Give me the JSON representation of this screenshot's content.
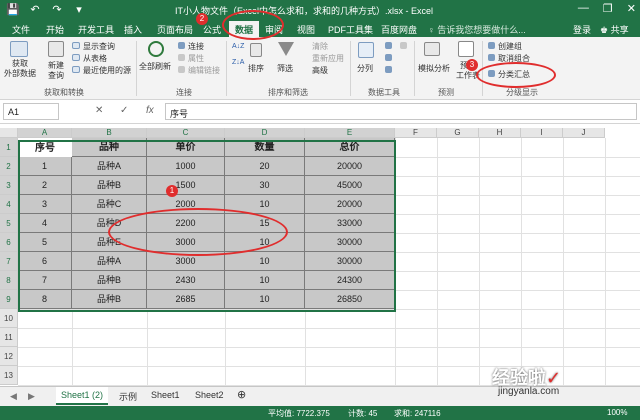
{
  "title_bar": {
    "title": "IT小人物文件（Excel中怎么求和，求和的几种方式）.xlsx - Excel",
    "qat": [
      "💾",
      "↶",
      "↷",
      "▾"
    ],
    "win_controls": [
      "—",
      "❐",
      "✕"
    ]
  },
  "tabs": {
    "items": [
      "文件",
      "开始",
      "开发工具",
      "插入",
      "页面布局",
      "公式",
      "数据",
      "审阅",
      "视图",
      "PDF工具集",
      "百度网盘"
    ],
    "active": "数据",
    "tell_me": "♀ 告诉我您想要做什么...",
    "login": "登录",
    "share": "♚ 共享"
  },
  "ribbon": {
    "get_external": "获取\n外部数据",
    "new_query": "新建\n查询",
    "show_query": "显示查询",
    "from_table": "从表格",
    "recent_sources": "最近使用的源",
    "group_get_transform": "获取和转换",
    "refresh_all": "全部刷新",
    "connections": "连接",
    "properties": "属性",
    "edit_links": "编辑链接",
    "group_connections": "连接",
    "sort_az": "A↓Z",
    "sort_za": "Z↓A",
    "sort": "排序",
    "filter": "筛选",
    "clear": "清除",
    "reapply": "重新应用",
    "advanced": "高级",
    "group_sort_filter": "排序和筛选",
    "split": "分列",
    "group_data_tools": "数据工具",
    "whatif": "模拟分析",
    "forecast": "预测\n工作表",
    "group_forecast": "预测",
    "group_combine": "创建组",
    "ungroup": "取消组合",
    "subtotal": "分类汇总",
    "group_outline": "分级显示"
  },
  "formula_bar": {
    "name_box": "A1",
    "cancel": "✕",
    "enter": "✓",
    "fx": "fx",
    "content": "序号"
  },
  "columns": [
    "A",
    "B",
    "C",
    "D",
    "E",
    "F",
    "G",
    "H",
    "I",
    "J"
  ],
  "rows": [
    "1",
    "2",
    "3",
    "4",
    "5",
    "6",
    "7",
    "8",
    "9",
    "10",
    "11",
    "12",
    "13"
  ],
  "table": {
    "headers": [
      "序号",
      "品种",
      "单价",
      "数量",
      "总价"
    ],
    "rows": [
      [
        "1",
        "品种A",
        "1000",
        "20",
        "20000"
      ],
      [
        "2",
        "品种B",
        "1500",
        "30",
        "45000"
      ],
      [
        "3",
        "品种C",
        "2000",
        "10",
        "20000"
      ],
      [
        "4",
        "品种D",
        "2200",
        "15",
        "33000"
      ],
      [
        "5",
        "品种E",
        "3000",
        "10",
        "30000"
      ],
      [
        "6",
        "品种A",
        "3000",
        "10",
        "30000"
      ],
      [
        "7",
        "品种B",
        "2430",
        "10",
        "24300"
      ],
      [
        "8",
        "品种B",
        "2685",
        "10",
        "26850"
      ]
    ]
  },
  "sheets": {
    "nav": [
      "◀",
      "▶"
    ],
    "tabs": [
      "Sheet1 (2)",
      "示例",
      "Sheet1",
      "Sheet2"
    ],
    "active": "Sheet1 (2)",
    "add": "⊕"
  },
  "status": {
    "average": "平均值: 7722.375",
    "count": "计数: 45",
    "sum": "求和: 247116",
    "zoom": "100%"
  },
  "annotations": [
    "1",
    "2",
    "3"
  ],
  "watermark": {
    "brand": "经验啦",
    "check": "✓",
    "url": "jingyanla.com"
  },
  "colors": {
    "excel_green": "#217346",
    "annotation_red": "#e02d2d",
    "cell_gray": "#c8c8c8"
  }
}
